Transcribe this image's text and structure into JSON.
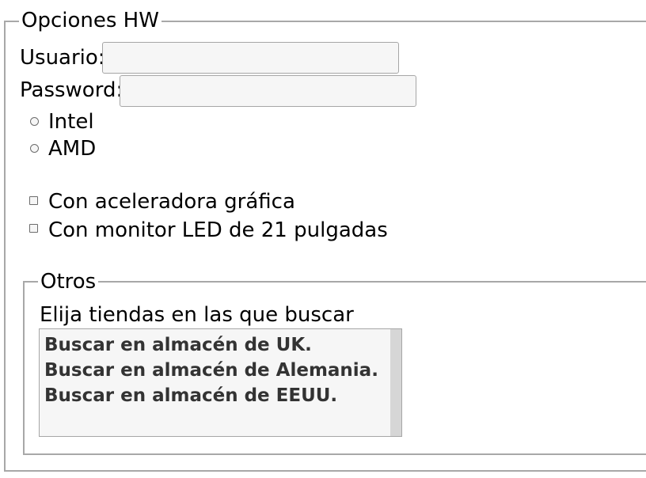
{
  "hw": {
    "legend": "Opciones HW",
    "usuario_label": "Usuario:",
    "usuario_value": "",
    "password_label": "Password:",
    "password_value": "",
    "radios": [
      {
        "label": "Intel",
        "checked": false
      },
      {
        "label": "AMD",
        "checked": false
      }
    ],
    "checkboxes": [
      {
        "label": "Con aceleradora gráfica",
        "checked": false
      },
      {
        "label": "Con monitor LED de 21 pulgadas",
        "checked": false
      }
    ]
  },
  "otros": {
    "legend": "Otros",
    "prompt": "Elija tiendas en las que buscar",
    "options": [
      "Buscar en almacén de UK.",
      "Buscar en almacén de Alemania.",
      "Buscar en almacén de EEUU."
    ]
  },
  "colors": {
    "border": "#a8a8a8",
    "input_bg": "#f6f6f6",
    "scrollbar": "#d6d6d6"
  }
}
